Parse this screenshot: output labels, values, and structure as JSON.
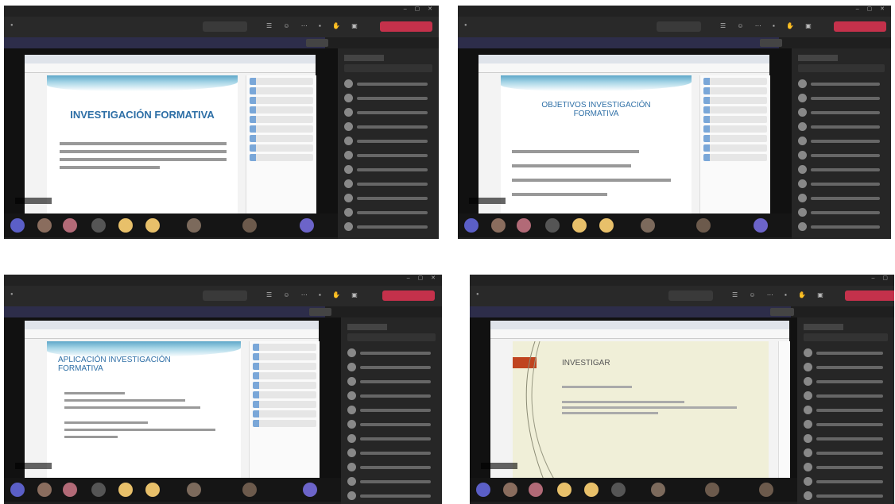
{
  "panels": [
    {
      "slide_title": "INVESTIGACIÓN FORMATIVA"
    },
    {
      "slide_title": "OBJETIVOS INVESTIGACIÓN FORMATIVA"
    },
    {
      "slide_title": "APLICACIÓN INVESTIGACIÓN FORMATIVA"
    },
    {
      "slide_title": "INVESTIGAR"
    }
  ],
  "colors": {
    "leave": "#c4314b",
    "title_blue": "#2e6fa6",
    "teams_dark": "#1f1f1f",
    "ribbon": "#c0441f"
  }
}
